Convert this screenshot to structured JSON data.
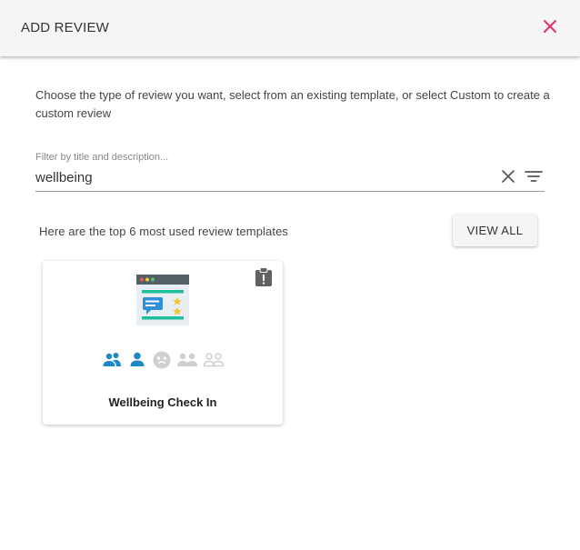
{
  "dialog": {
    "title": "ADD REVIEW",
    "close_icon": "close-icon",
    "accent_color": "#e0306f"
  },
  "intro_text": "Choose the type of review you want, select from an existing template, or select Custom to create a custom review",
  "filter": {
    "placeholder": "Filter by title and description...",
    "value": "wellbeing",
    "clear_icon": "clear-icon",
    "filter_icon": "filter-icon"
  },
  "templates": {
    "heading": "Here are the top 6 most used review templates",
    "view_all_label": "VIEW ALL",
    "cards": [
      {
        "title": "Wellbeing Check In",
        "badge_icon": "clipboard-alert-icon",
        "illustration_icon": "review-form-illustration-icon",
        "participant_icons": [
          {
            "name": "group-icon",
            "active": true
          },
          {
            "name": "person-icon",
            "active": true
          },
          {
            "name": "anonymous-face-icon",
            "active": false
          },
          {
            "name": "pair-icon",
            "active": false
          },
          {
            "name": "pair-outline-icon",
            "active": false
          }
        ],
        "active_color": "#1e88c7",
        "inactive_color": "#d0d0d0"
      }
    ]
  }
}
